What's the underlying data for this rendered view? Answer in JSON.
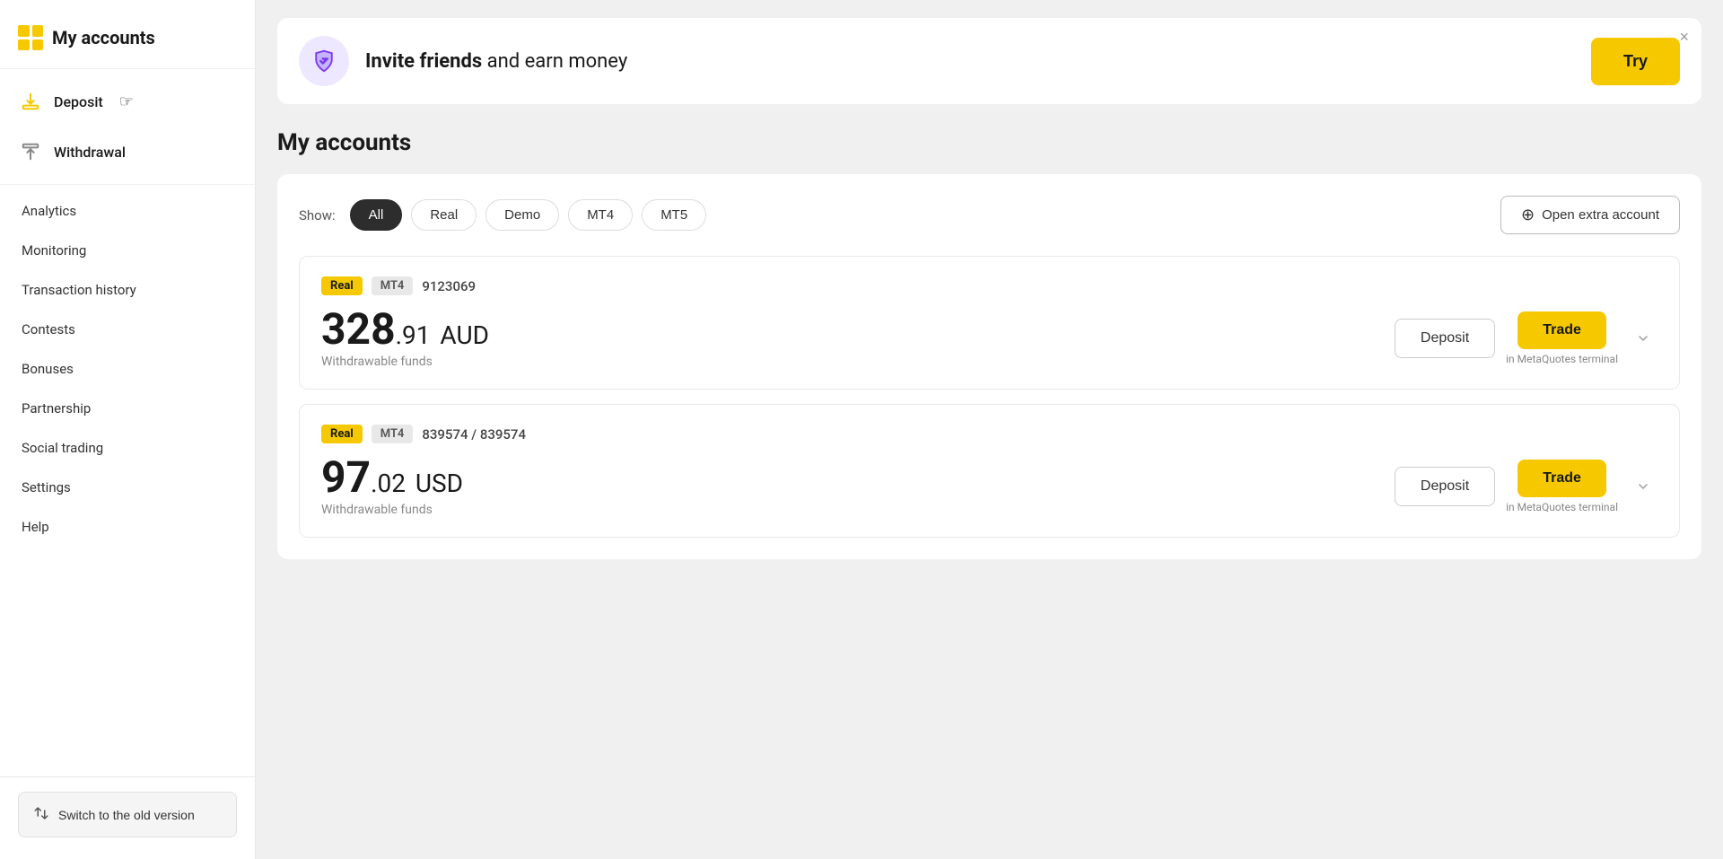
{
  "sidebar": {
    "my_accounts_label": "My accounts",
    "deposit_label": "Deposit",
    "withdrawal_label": "Withdrawal",
    "nav_items": [
      {
        "id": "analytics",
        "label": "Analytics"
      },
      {
        "id": "monitoring",
        "label": "Monitoring"
      },
      {
        "id": "transaction-history",
        "label": "Transaction history"
      },
      {
        "id": "contests",
        "label": "Contests"
      },
      {
        "id": "bonuses",
        "label": "Bonuses"
      },
      {
        "id": "partnership",
        "label": "Partnership"
      },
      {
        "id": "social-trading",
        "label": "Social trading"
      },
      {
        "id": "settings",
        "label": "Settings"
      },
      {
        "id": "help",
        "label": "Help"
      }
    ],
    "switch_version_label": "Switch to the old version"
  },
  "banner": {
    "title_bold": "Invite friends",
    "title_normal": " and earn money",
    "try_label": "Try",
    "close_label": "×"
  },
  "main": {
    "section_title": "My accounts",
    "filter": {
      "show_label": "Show:",
      "options": [
        {
          "id": "all",
          "label": "All",
          "active": true
        },
        {
          "id": "real",
          "label": "Real",
          "active": false
        },
        {
          "id": "demo",
          "label": "Demo",
          "active": false
        },
        {
          "id": "mt4",
          "label": "MT4",
          "active": false
        },
        {
          "id": "mt5",
          "label": "MT5",
          "active": false
        }
      ],
      "open_account_label": "Open extra account",
      "plus_icon": "+"
    },
    "accounts": [
      {
        "id": "account-1",
        "type_badge": "Real",
        "platform_badge": "MT4",
        "account_number": "9123069",
        "balance_main": "328",
        "balance_decimal": ".91",
        "currency": "AUD",
        "withdrawable_label": "Withdrawable funds",
        "deposit_label": "Deposit",
        "trade_label": "Trade",
        "trade_meta": "in MetaQuotes terminal"
      },
      {
        "id": "account-2",
        "type_badge": "Real",
        "platform_badge": "MT4",
        "account_number": "839574 / 839574",
        "balance_main": "97",
        "balance_decimal": ".02",
        "currency": "USD",
        "withdrawable_label": "Withdrawable funds",
        "deposit_label": "Deposit",
        "trade_label": "Trade",
        "trade_meta": "in MetaQuotes terminal"
      }
    ]
  }
}
